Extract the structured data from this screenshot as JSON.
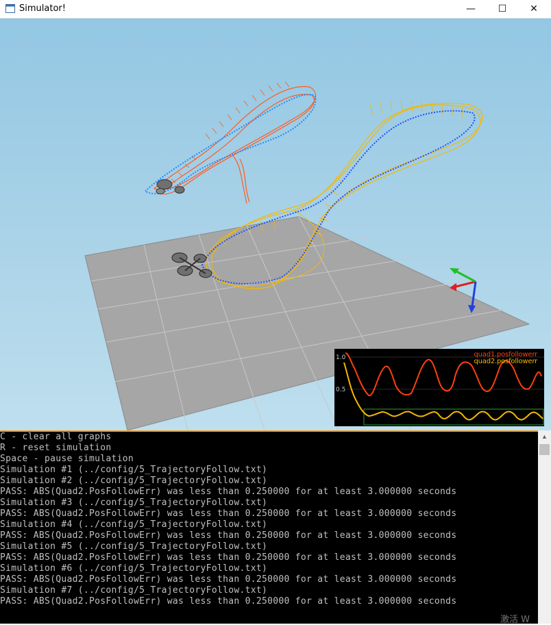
{
  "window": {
    "title": "Simulator!",
    "minimize_glyph": "—",
    "maximize_glyph": "☐",
    "close_glyph": "✕",
    "app_icon": "window-icon"
  },
  "graph": {
    "tick_high": "1.0",
    "tick_mid": "0.5",
    "legend": [
      {
        "name": "quad1.posfollowerr",
        "color": "#ff4010"
      },
      {
        "name": "quad2.posfollowerr",
        "color": "#f5b800"
      }
    ]
  },
  "console": {
    "lines": [
      "C - clear all graphs",
      "R - reset simulation",
      "Space - pause simulation",
      "Simulation #1 (../config/5_TrajectoryFollow.txt)",
      "Simulation #2 (../config/5_TrajectoryFollow.txt)",
      "PASS: ABS(Quad2.PosFollowErr) was less than 0.250000 for at least 3.000000 seconds",
      "Simulation #3 (../config/5_TrajectoryFollow.txt)",
      "PASS: ABS(Quad2.PosFollowErr) was less than 0.250000 for at least 3.000000 seconds",
      "Simulation #4 (../config/5_TrajectoryFollow.txt)",
      "PASS: ABS(Quad2.PosFollowErr) was less than 0.250000 for at least 3.000000 seconds",
      "Simulation #5 (../config/5_TrajectoryFollow.txt)",
      "PASS: ABS(Quad2.PosFollowErr) was less than 0.250000 for at least 3.000000 seconds",
      "Simulation #6 (../config/5_TrajectoryFollow.txt)",
      "PASS: ABS(Quad2.PosFollowErr) was less than 0.250000 for at least 3.000000 seconds",
      "Simulation #7 (../config/5_TrajectoryFollow.txt)",
      "PASS: ABS(Quad2.PosFollowErr) was less than 0.250000 for at least 3.000000 seconds"
    ]
  },
  "watermark": "激活 W",
  "colors": {
    "quad1_trail": "#ff5a1e",
    "quad2_trail": "#f5b800",
    "target_path": "#1e6fff",
    "floor": "#a8a8a8"
  }
}
